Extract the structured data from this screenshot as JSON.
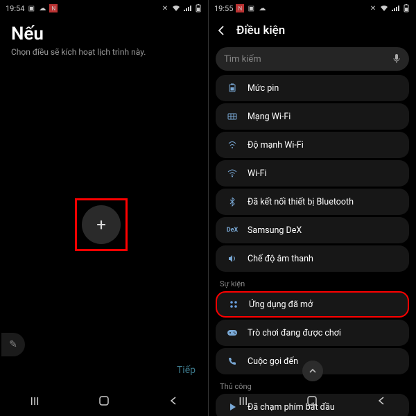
{
  "left": {
    "status_time": "19:54",
    "title": "Nếu",
    "subtitle": "Chọn điều sẽ kích hoạt lịch trình này.",
    "add_label": "+",
    "next_label": "Tiếp"
  },
  "right": {
    "status_time": "19:55",
    "header_title": "Điều kiện",
    "search_placeholder": "Tìm kiếm",
    "items_main": [
      {
        "icon": "battery",
        "label": "Mức pin"
      },
      {
        "icon": "wifi-grid",
        "label": "Mạng Wi-Fi"
      },
      {
        "icon": "wifi-signal",
        "label": "Độ mạnh Wi-Fi"
      },
      {
        "icon": "wifi",
        "label": "Wi-Fi"
      },
      {
        "icon": "bluetooth",
        "label": "Đã kết nối thiết bị Bluetooth"
      },
      {
        "icon": "dex",
        "label": "Samsung DeX"
      },
      {
        "icon": "volume",
        "label": "Chế độ âm thanh"
      }
    ],
    "section_event": "Sự kiện",
    "items_event": [
      {
        "icon": "apps",
        "label": "Ứng dụng đã mở",
        "hl": true
      },
      {
        "icon": "game",
        "label": "Trò chơi đang được chơi"
      },
      {
        "icon": "phone",
        "label": "Cuộc gọi đến"
      }
    ],
    "section_manual": "Thủ công",
    "items_manual": [
      {
        "icon": "play",
        "label": "Đã chạm phím bắt đầu"
      }
    ]
  }
}
